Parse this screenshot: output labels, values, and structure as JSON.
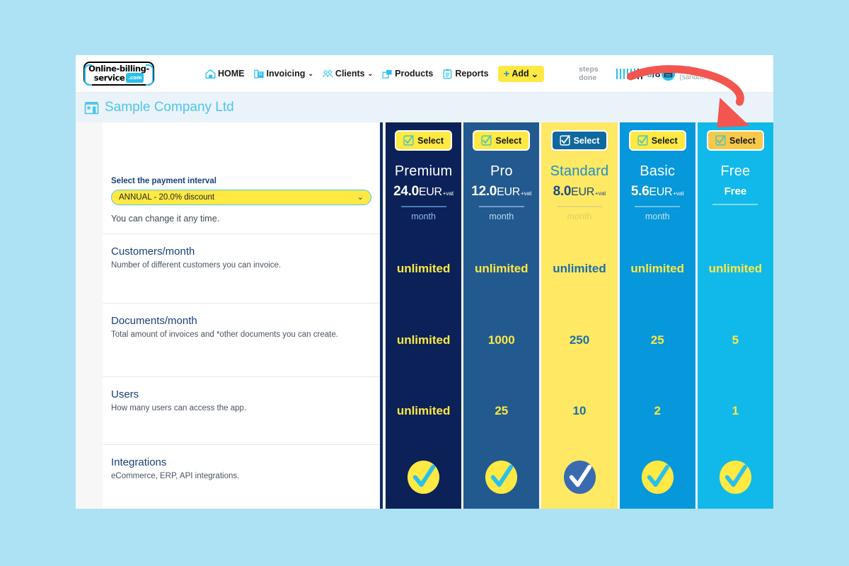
{
  "nav": {
    "items": [
      {
        "label": "HOME",
        "icon": "home-icon",
        "caret": false
      },
      {
        "label": "Invoicing",
        "icon": "invoicing-icon",
        "caret": true
      },
      {
        "label": "Clients",
        "icon": "clients-icon",
        "caret": true
      },
      {
        "label": "Products",
        "icon": "products-icon",
        "caret": false
      },
      {
        "label": "Reports",
        "icon": "reports-icon",
        "caret": false
      }
    ],
    "add_label": "Add",
    "add_caret": "⌄",
    "caret": "⌄"
  },
  "logo": {
    "line1": "Online-billing-",
    "line2": "service",
    "tld": ".com"
  },
  "steps": {
    "label": "steps done",
    "count": "6",
    "separator": "/",
    "total": "8",
    "marks_filled": 6,
    "marks_total": 8
  },
  "user": {
    "name": "John",
    "sub": "(sandbox)",
    "avatar_icon": "user-avatar-icon"
  },
  "company": {
    "name": "Sample Company Ltd",
    "icon": "company-building-icon"
  },
  "interval": {
    "label": "Select the payment interval",
    "value": "ANNUAL - 20.0% discount",
    "caret": "⌄",
    "hint": "You can change it any time."
  },
  "features": [
    {
      "title": "Customers/month",
      "desc": "Number of different customers you can invoice."
    },
    {
      "title": "Documents/month",
      "desc": "Total amount of invoices and *other documents you can create."
    },
    {
      "title": "Users",
      "desc": "How many users can access the app."
    },
    {
      "title": "Integrations",
      "desc": "eCommerce, ERP, API integrations."
    }
  ],
  "select_label": "Select",
  "per_label": "month",
  "plans": [
    {
      "name": "Premium",
      "price": "24.0",
      "currency": "EUR",
      "vat": "+vat",
      "per": "month",
      "bg": "#0b2158",
      "name_color": "#ffffff",
      "price_color": "#ffffff",
      "per_color": "#8fb9e8",
      "rule_color": "#4f7ab5",
      "value_color": "#ffe942",
      "btn_bg": "#ffe942",
      "btn_text": "#14181c",
      "btn_check": "#49c7c0",
      "check_circle": "#ffe942",
      "check_mark": "#29c0ee",
      "values": [
        "unlimited",
        "unlimited",
        "unlimited",
        "check"
      ]
    },
    {
      "name": "Pro",
      "price": "12.0",
      "currency": "EUR",
      "vat": "+vat",
      "per": "month",
      "bg": "#22598f",
      "name_color": "#ffffff",
      "price_color": "#ffffff",
      "per_color": "#bcd8f2",
      "rule_color": "#6f9ece",
      "value_color": "#ffe942",
      "btn_bg": "#ffe942",
      "btn_text": "#14181c",
      "btn_check": "#49c7c0",
      "check_circle": "#ffe942",
      "check_mark": "#29c0ee",
      "values": [
        "unlimited",
        "1000",
        "25",
        "check"
      ]
    },
    {
      "name": "Standard",
      "price": "8.0",
      "currency": "EUR",
      "vat": "+vat",
      "per": "month",
      "bg": "#ffe863",
      "name_color": "#1d8fc9",
      "price_color": "#1b4a85",
      "per_color": "#e2cf63",
      "rule_color": "#e5d477",
      "value_color": "#1b6fa8",
      "btn_bg": "#10699e",
      "btn_text": "#ffffff",
      "btn_check": "#ffffff",
      "check_circle": "#3a6ab0",
      "check_mark": "#ffffff",
      "values": [
        "unlimited",
        "250",
        "10",
        "check"
      ]
    },
    {
      "name": "Basic",
      "price": "5.6",
      "currency": "EUR",
      "vat": "+vat",
      "per": "month",
      "bg": "#0797db",
      "name_color": "#ffffff",
      "price_color": "#ffffff",
      "per_color": "#bfe4f7",
      "rule_color": "#6dc3ea",
      "value_color": "#ffe942",
      "btn_bg": "#ffe942",
      "btn_text": "#14181c",
      "btn_check": "#49c7c0",
      "check_circle": "#ffe942",
      "check_mark": "#29c0ee",
      "values": [
        "unlimited",
        "25",
        "2",
        "check"
      ]
    },
    {
      "name": "Free",
      "price": "Free",
      "currency": "",
      "vat": "",
      "per": "",
      "bg": "#11b9ea",
      "name_color": "#ffffff",
      "price_color": "#ffffff",
      "per_color": "#bfe4f7",
      "rule_color": "#86d6f2",
      "value_color": "#ffe942",
      "btn_bg": "#f8c84a",
      "btn_text": "#14181c",
      "btn_check": "#49c7c0",
      "check_circle": "#ffe942",
      "check_mark": "#29c0ee",
      "values": [
        "unlimited",
        "5",
        "1",
        "check"
      ]
    }
  ],
  "annotation": {
    "arrow_color": "#f2564f",
    "arrow_target": "free-plan-select-button"
  },
  "colors": {
    "page_bg": "#ade2f4",
    "accent_yellow": "#ffe942",
    "accent_cyan": "#29c0ee",
    "deep_blue": "#0b2158"
  }
}
